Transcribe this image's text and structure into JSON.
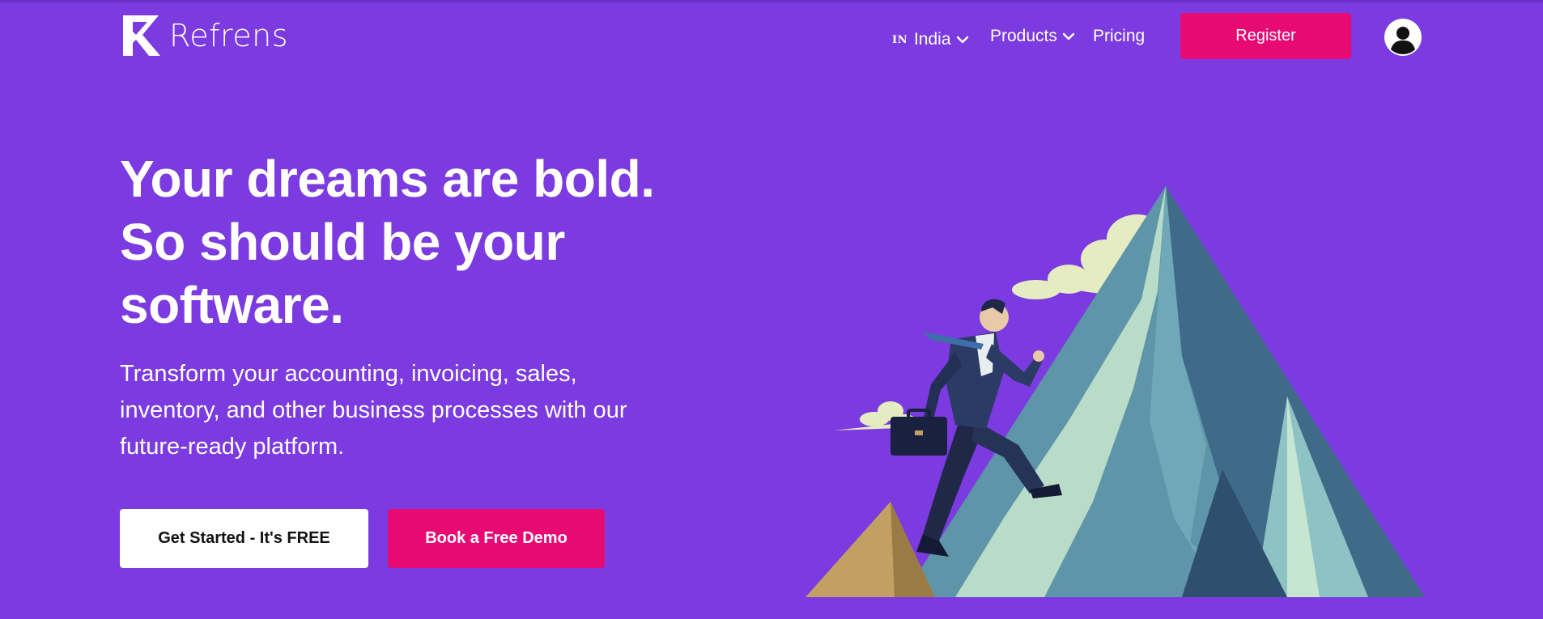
{
  "header": {
    "brand": "Refrens",
    "country_code": "IN",
    "country": "India",
    "nav": [
      {
        "label": "Products"
      },
      {
        "label": "Pricing"
      }
    ],
    "register_label": "Register"
  },
  "hero": {
    "headline_lines": [
      "Your dreams are bold.",
      "So should be your",
      "software."
    ],
    "subtext_lines": [
      "Transform your accounting, invoicing, sales,",
      "inventory, and other business processes with our",
      "future-ready platform."
    ],
    "cta_primary": "Get Started - It's FREE",
    "cta_secondary": "Book a Free Demo"
  },
  "icons": [
    "refrens-logo-icon",
    "chevron-down-icon",
    "user-avatar-icon"
  ],
  "colors": {
    "background": "#7b3be0",
    "accent": "#e80a73",
    "button_light": "#ffffff"
  }
}
